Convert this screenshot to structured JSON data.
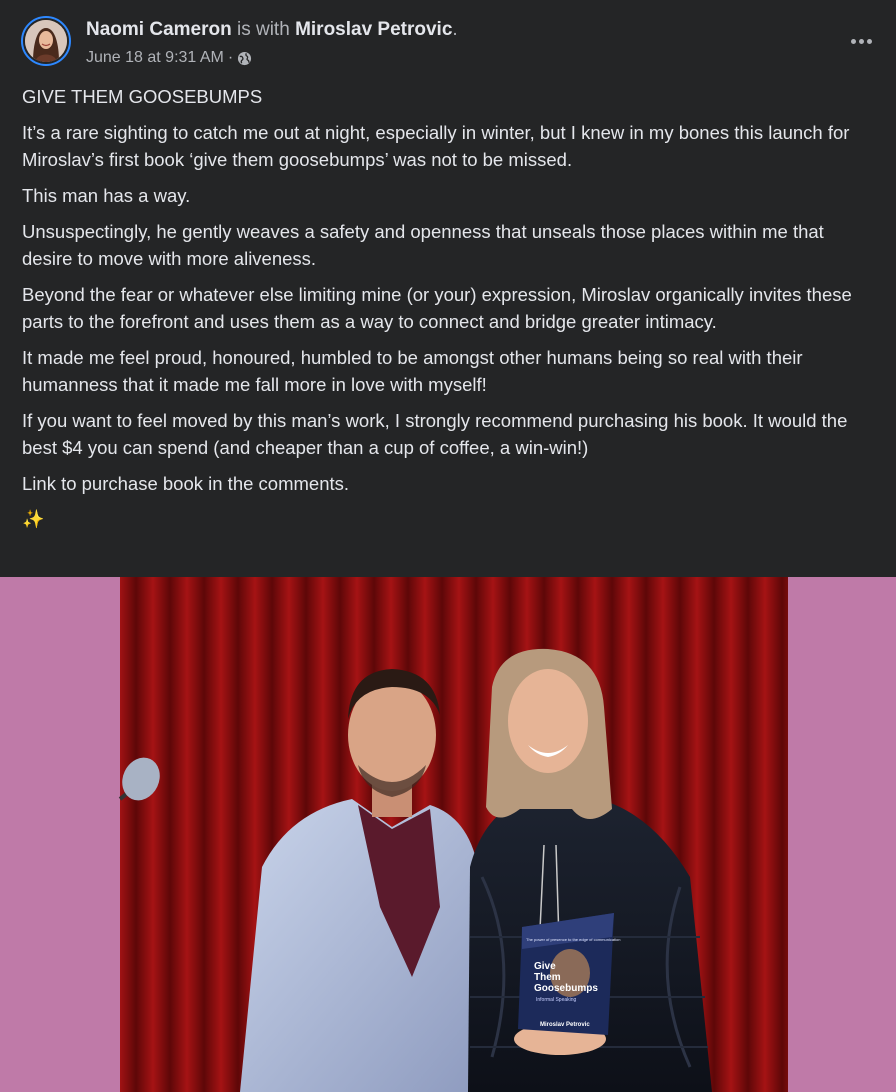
{
  "post": {
    "author": "Naomi Cameron",
    "with_text": "is with",
    "tagged": "Miroslav Petrovic",
    "period": ".",
    "timestamp": "June 18 at 9:31 AM",
    "separator": "·",
    "privacy_icon": "globe-icon",
    "more_icon": "more-horizontal-icon",
    "paragraphs": [
      "GIVE THEM GOOSEBUMPS",
      "It’s a rare sighting to catch me out at night, especially in winter, but I knew in my bones this launch for Miroslav’s first book ‘give them goosebumps’ was not to be missed.",
      "This man has a way.",
      "Unsuspectingly, he gently weaves a safety and openness that unseals those places within me that desire to move with more aliveness.",
      "Beyond the fear or whatever else limiting mine (or your) expression, Miroslav organically invites these parts to the forefront and uses them as a way to connect and bridge greater intimacy.",
      "It made me feel proud, honoured, humbled to be amongst other humans being so real with their humanness that it made me fall more in love with myself!",
      "If you want to feel moved by this man’s work, I strongly recommend purchasing his book. It would the best $4 you can spend (and cheaper than a cup of coffee, a win-win!)",
      "Link to purchase book in the comments."
    ],
    "emoji": "✨"
  },
  "photo": {
    "book_title_lines": [
      "Give",
      "Them",
      "Goosebumps"
    ],
    "book_subtitle": "Informal Speaking",
    "book_author": "Miroslav Petrovic",
    "book_tagline": "The power of presence to the edge of communication"
  },
  "colors": {
    "background": "#242526",
    "text_primary": "#e4e6eb",
    "text_secondary": "#b0b3b8",
    "avatar_ring": "#2d88ff",
    "photo_backdrop": "#bf7aa8",
    "curtain": "#8e0f10"
  }
}
